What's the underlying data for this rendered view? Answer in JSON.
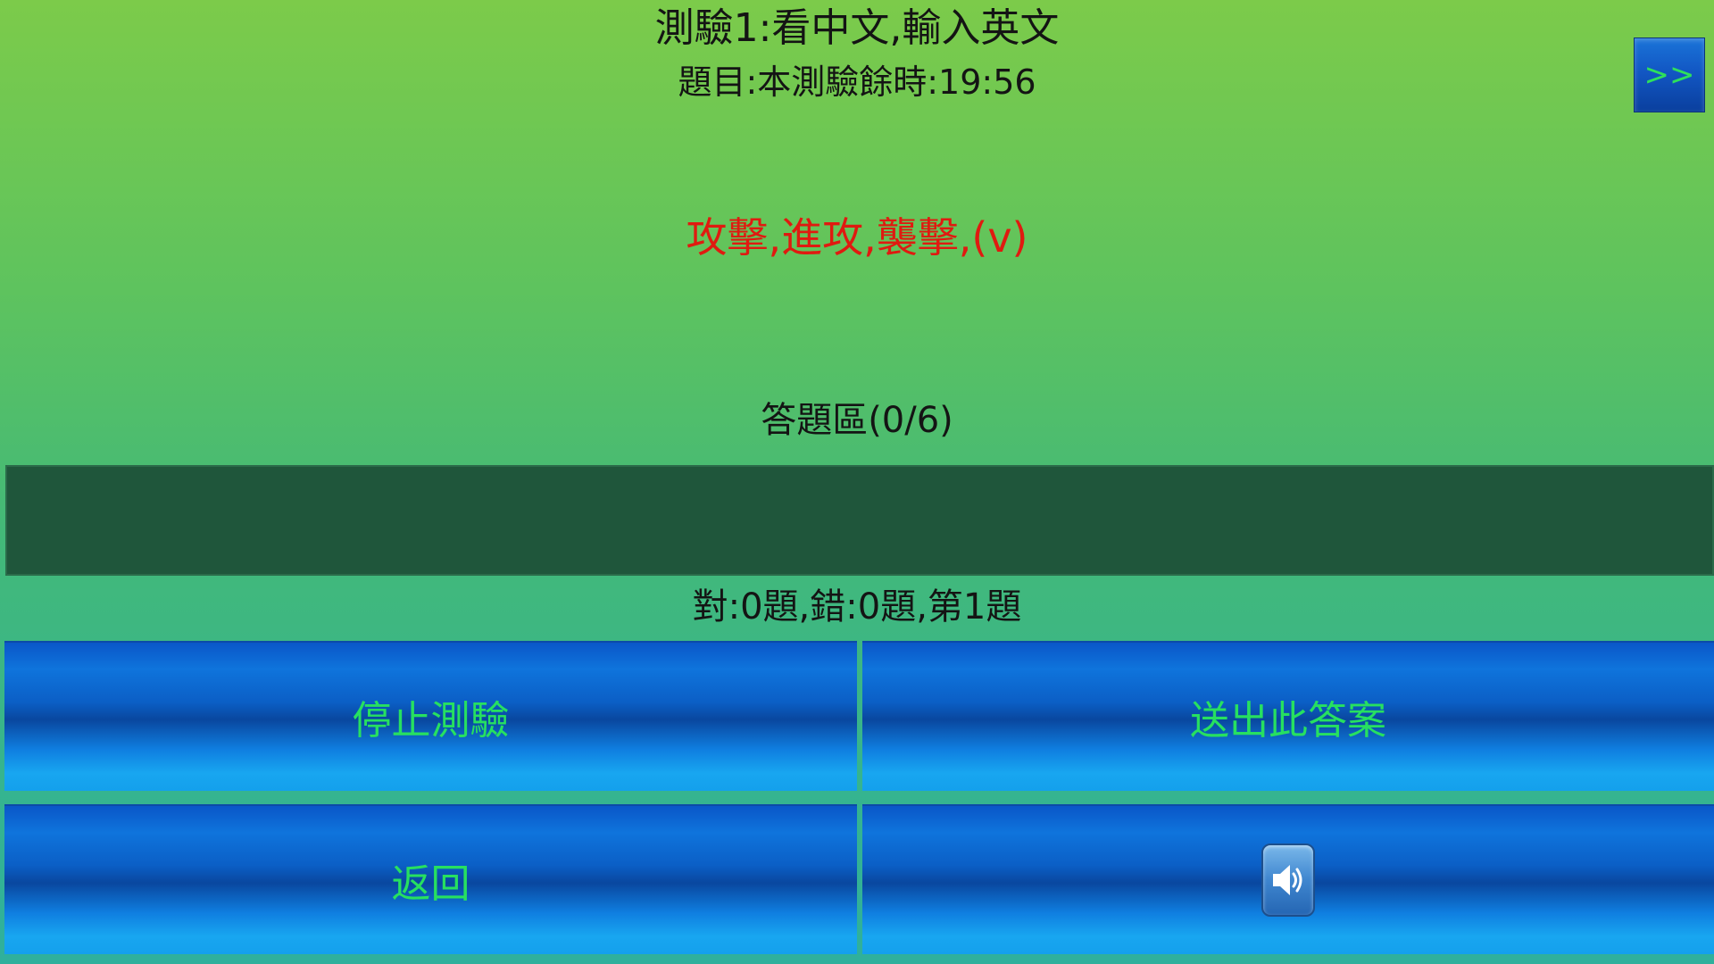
{
  "header": {
    "title": "測驗1:看中文,輸入英文",
    "timer": "題目:本測驗餘時:19:56",
    "next_label": ">>"
  },
  "question": {
    "text": "攻擊,進攻,襲擊,(v)",
    "color": "#e01a10"
  },
  "answer": {
    "label": "答題區(0/6)",
    "value": "",
    "placeholder": ""
  },
  "score": {
    "text": "對:0題,錯:0題,第1題"
  },
  "buttons": {
    "stop_label": "停止測驗",
    "send_label": "送出此答案",
    "back_label": "返回",
    "sound_icon": "speaker-icon"
  },
  "colors": {
    "button_text": "#27e060",
    "input_background": "#1f563b"
  }
}
